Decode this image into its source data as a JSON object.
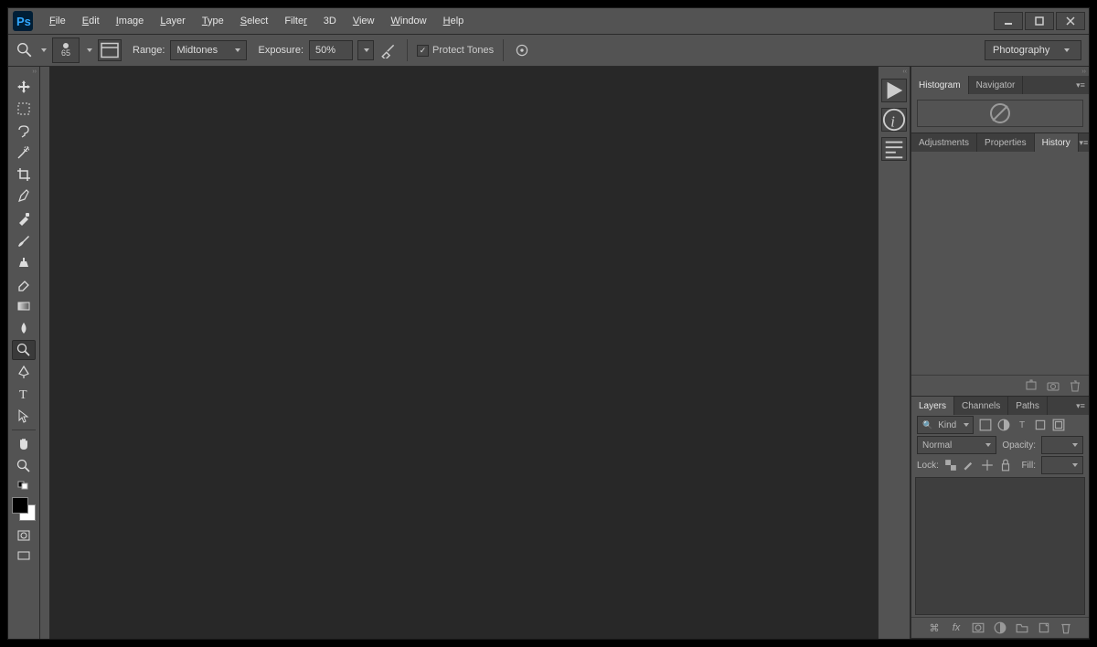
{
  "menu": {
    "file": "File",
    "edit": "Edit",
    "image": "Image",
    "layer": "Layer",
    "type": "Type",
    "select": "Select",
    "filter": "Filter",
    "three_d": "3D",
    "view": "View",
    "window": "Window",
    "help": "Help"
  },
  "options": {
    "brush_size": "65",
    "range_label": "Range:",
    "range_value": "Midtones",
    "exposure_label": "Exposure:",
    "exposure_value": "50%",
    "protect_label": "Protect Tones",
    "workspace": "Photography"
  },
  "panels": {
    "histogram_tab": "Histogram",
    "navigator_tab": "Navigator",
    "adjustments_tab": "Adjustments",
    "properties_tab": "Properties",
    "history_tab": "History",
    "layers_tab": "Layers",
    "channels_tab": "Channels",
    "paths_tab": "Paths"
  },
  "layers": {
    "kind": "Kind",
    "blend": "Normal",
    "opacity_label": "Opacity:",
    "lock_label": "Lock:",
    "fill_label": "Fill:"
  }
}
